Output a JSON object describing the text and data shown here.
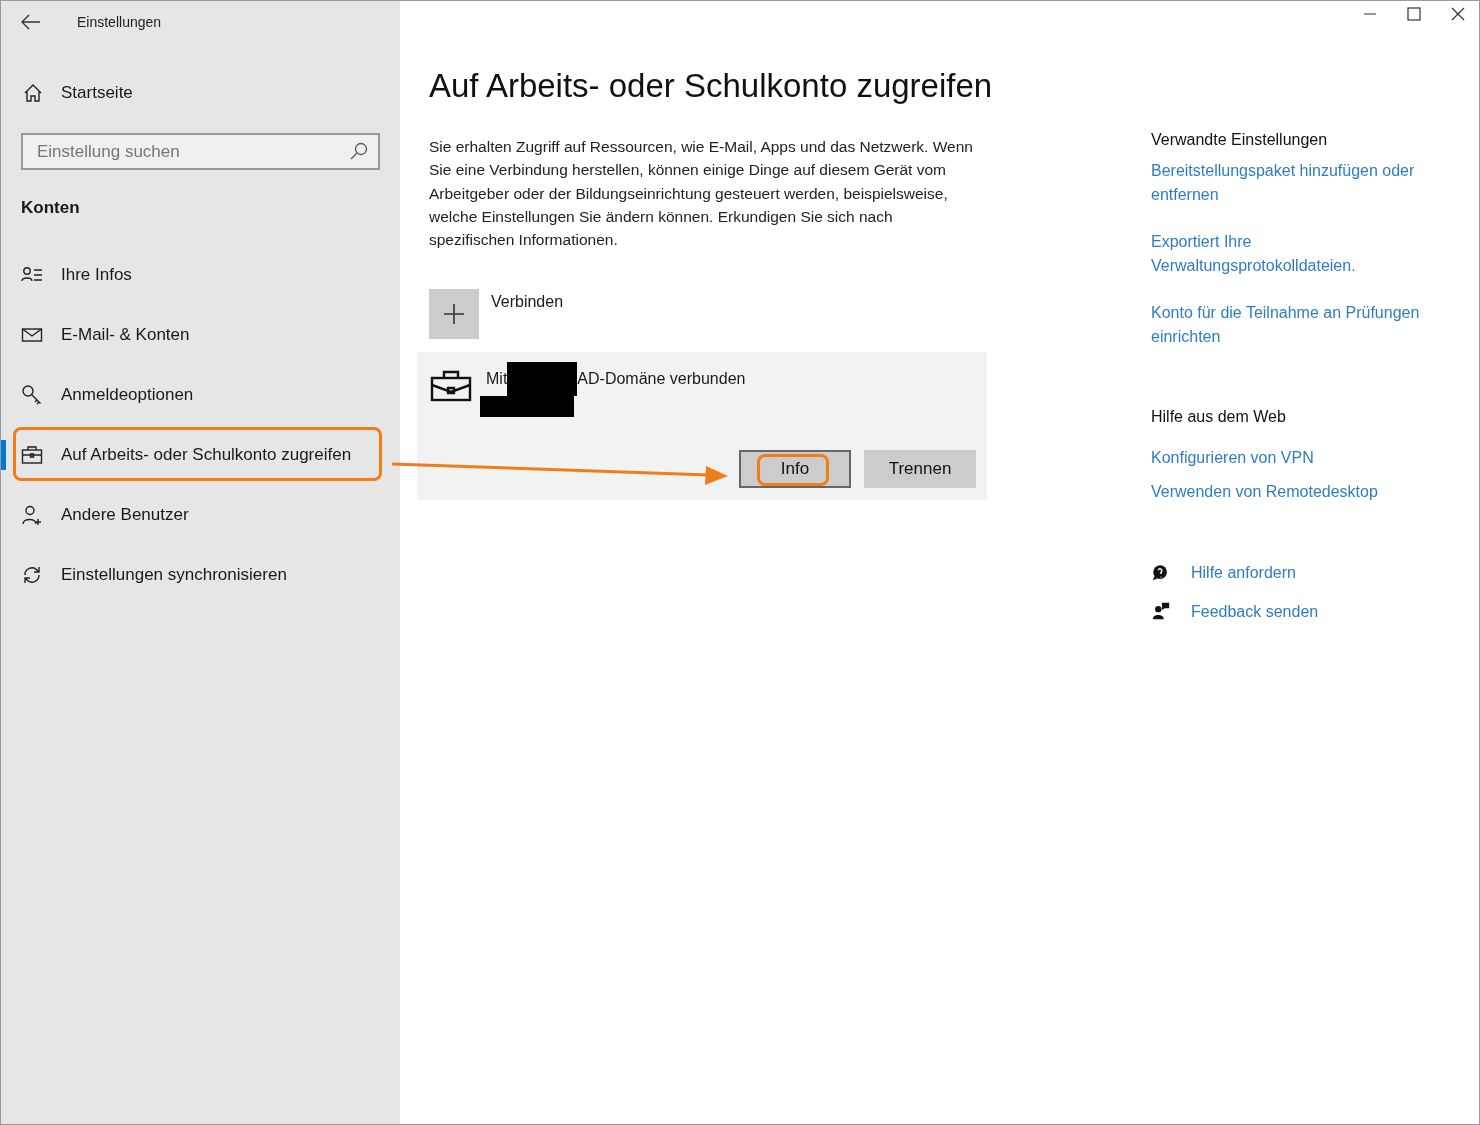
{
  "window": {
    "title": "Einstellungen"
  },
  "sidebar": {
    "home": "Startseite",
    "search": {
      "placeholder": "Einstellung suchen"
    },
    "section": "Konten",
    "items": [
      {
        "label": "Ihre Infos",
        "selected": false,
        "highlighted": false
      },
      {
        "label": "E-Mail- & Konten",
        "selected": false,
        "highlighted": false
      },
      {
        "label": "Anmeldeoptionen",
        "selected": false,
        "highlighted": false
      },
      {
        "label": "Auf Arbeits- oder Schulkonto zugreifen",
        "selected": true,
        "highlighted": true
      },
      {
        "label": "Andere Benutzer",
        "selected": false,
        "highlighted": false
      },
      {
        "label": "Einstellungen synchronisieren",
        "selected": false,
        "highlighted": false
      }
    ]
  },
  "page": {
    "title": "Auf Arbeits- oder Schulkonto zugreifen",
    "description": "Sie erhalten Zugriff auf Ressourcen, wie E-Mail, Apps und das Netzwerk. Wenn Sie eine Verbindung herstellen, können einige Dinge auf diesem Gerät vom Arbeitgeber oder der Bildungseinrichtung gesteuert werden, beispielsweise, welche Einstellungen Sie ändern können. Erkundigen Sie sich nach spezifischen Informationen.",
    "connect": {
      "label": "Verbinden"
    },
    "account": {
      "prefix": "Mit",
      "suffix": "AD-Domäne verbunden",
      "buttons": [
        {
          "label": "Info",
          "focused": true,
          "highlighted": true
        },
        {
          "label": "Trennen",
          "focused": false,
          "highlighted": false
        }
      ]
    }
  },
  "related": {
    "heading": "Verwandte Einstellungen",
    "links": [
      "Bereitstellungspaket hinzufügen oder entfernen",
      "Exportiert Ihre Verwaltungsprotokolldateien.",
      "Konto für die Teilnahme an Prüfungen einrichten"
    ]
  },
  "web_help": {
    "heading": "Hilfe aus dem Web",
    "links": [
      "Konfigurieren von VPN",
      "Verwenden von Remotedesktop"
    ]
  },
  "support": [
    {
      "label": "Hilfe anfordern"
    },
    {
      "label": "Feedback senden"
    }
  ]
}
